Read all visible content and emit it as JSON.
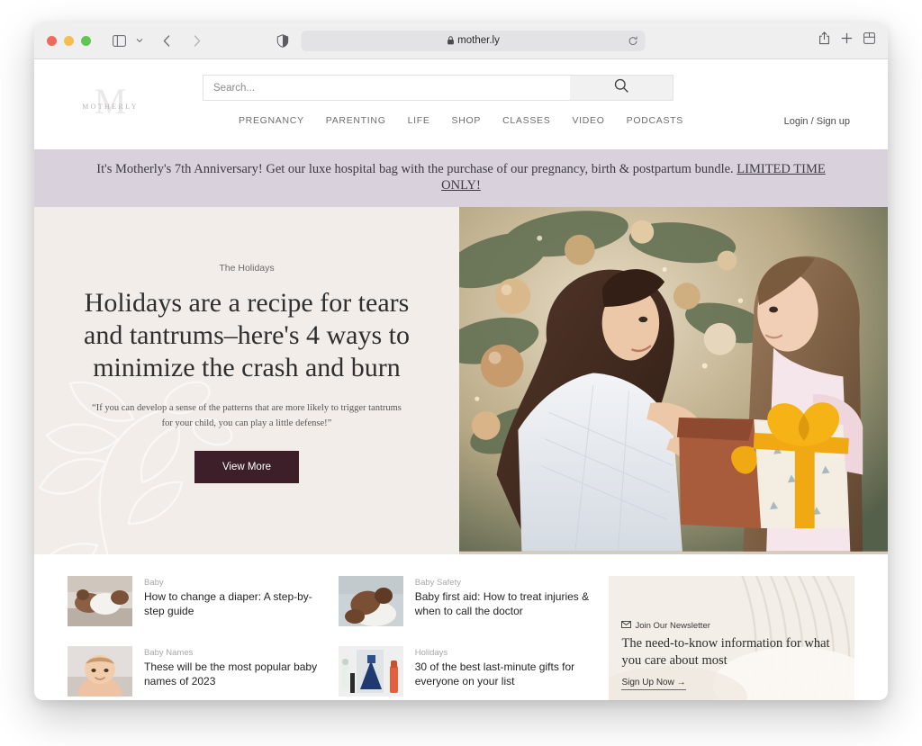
{
  "browser": {
    "url": "mother.ly",
    "icons": {
      "sidebar": "sidebar-toggle-icon",
      "chevron": "chevron-down-icon",
      "back": "back-arrow-icon",
      "forward": "forward-arrow-icon",
      "shield": "privacy-shield-icon",
      "lock": "lock-icon",
      "reload": "reload-icon",
      "share": "share-icon",
      "new_tab": "plus-icon",
      "tab_overview": "tab-overview-icon"
    },
    "traffic_lights": [
      "close",
      "minimize",
      "maximize"
    ]
  },
  "site": {
    "logo_mark": "M",
    "logo_word": "MOTHERLY",
    "search": {
      "placeholder": "Search...",
      "value": "",
      "button_icon": "search-icon"
    },
    "account_label": "Login / Sign up",
    "nav": [
      {
        "label": "PREGNANCY"
      },
      {
        "label": "PARENTING"
      },
      {
        "label": "LIFE"
      },
      {
        "label": "SHOP"
      },
      {
        "label": "CLASSES"
      },
      {
        "label": "VIDEO"
      },
      {
        "label": "PODCASTS"
      }
    ]
  },
  "announcement": {
    "text": "It's Motherly's 7th Anniversary! Get our luxe hospital bag with the purchase of our pregnancy, birth & postpartum bundle. ",
    "link_text": "LIMITED TIME ONLY!",
    "background": "#d9d2dc"
  },
  "hero": {
    "eyebrow": "The Holidays",
    "title": "Holidays are a recipe for tears and tantrums–here's 4 ways to minimize the crash and burn",
    "quote": "“If you can develop a sense of the patterns that are more likely to trigger tantrums for your child, you can play a little defense!”",
    "button_label": "View More",
    "button_color": "#3d1f2a",
    "background": "#f2ede9",
    "image_alt": "Mother kneeling with daughter holding a gold-ribboned gift in front of a decorated Christmas tree"
  },
  "cards": {
    "column_one": [
      {
        "category": "Baby",
        "title": "How to change a diaper: A step-by-step guide",
        "image_alt": "Baby being changed on a changing table"
      },
      {
        "category": "Baby Names",
        "title": "These will be the most popular baby names of 2023",
        "image_alt": "Smiling baby lying on a bed"
      }
    ],
    "column_two": [
      {
        "category": "Baby Safety",
        "title": "Baby first aid: How to treat injuries & when to call the doctor",
        "image_alt": "Baby lying on a white blanket"
      },
      {
        "category": "Holidays",
        "title": "30 of the best last-minute gifts for everyone on your list",
        "image_alt": "Assorted gift products including bottles and boxes"
      }
    ]
  },
  "newsletter": {
    "kicker": "Join Our Newsletter",
    "kicker_icon": "envelope-icon",
    "headline": "The need-to-know information for what you care about most",
    "cta": "Sign Up Now →",
    "image_alt": "Soft neutral fabric texture background"
  }
}
